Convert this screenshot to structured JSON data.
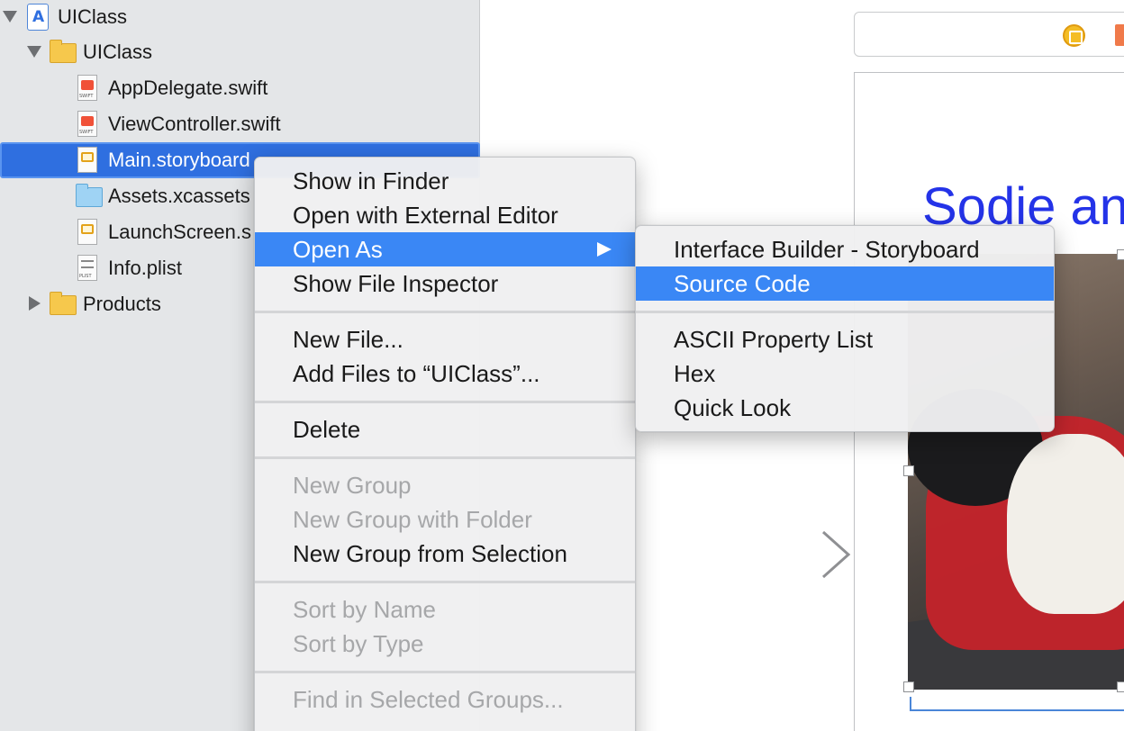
{
  "navigator": {
    "project": {
      "label": "UIClass"
    },
    "group": {
      "label": "UIClass"
    },
    "files": [
      {
        "label": "AppDelegate.swift",
        "kind": "swift"
      },
      {
        "label": "ViewController.swift",
        "kind": "swift"
      },
      {
        "label": "Main.storyboard",
        "kind": "storyboard",
        "selected": true
      },
      {
        "label": "Assets.xcassets",
        "kind": "assets"
      },
      {
        "label": "LaunchScreen.s",
        "kind": "storyboard"
      },
      {
        "label": "Info.plist",
        "kind": "plist"
      }
    ],
    "products": {
      "label": "Products"
    },
    "swift_badge": "SWIFT",
    "plist_badge": "PLIST"
  },
  "context_menu": {
    "show_in_finder": "Show in Finder",
    "open_external": "Open with External Editor",
    "open_as": "Open As",
    "show_inspector": "Show File Inspector",
    "new_file": "New File...",
    "add_files": "Add Files to “UIClass”...",
    "delete": "Delete",
    "new_group": "New Group",
    "new_group_folder": "New Group with Folder",
    "new_group_selection": "New Group from Selection",
    "sort_name": "Sort by Name",
    "sort_type": "Sort by Type",
    "find_in_groups": "Find in Selected Groups..."
  },
  "open_as_submenu": {
    "interface_builder": "Interface Builder - Storyboard",
    "source_code": "Source Code",
    "ascii_plist": "ASCII Property List",
    "hex": "Hex",
    "quick_look": "Quick Look"
  },
  "canvas": {
    "scene_label": "Sodie an"
  },
  "colors": {
    "selection": "#2f6fe0",
    "menu_highlight": "#3a87f5",
    "scene_label": "#2433e8"
  }
}
